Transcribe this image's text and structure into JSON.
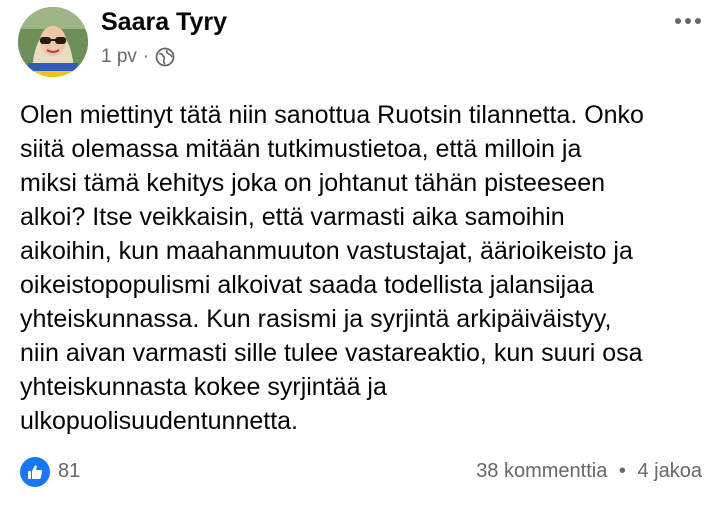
{
  "post": {
    "author": "Saara Tyry",
    "time": "1 pv",
    "separator": "·",
    "lines": [
      "Olen miettinyt tätä niin sanottua Ruotsin tilannetta. Onko",
      "siitä olemassa mitään tutkimustietoa, että milloin ja",
      "miksi tämä kehitys joka on johtanut tähän pisteeseen",
      "alkoi? Itse veikkaisin, että varmasti aika samoihin",
      "aikoihin, kun maahanmuuton vastustajat, äärioikeisto ja",
      "oikeistopopulismi alkoivat saada todellista jalansijaa",
      "yhteiskunnassa. Kun rasismi ja syrjintä arkipäiväistyy,",
      "niin aivan varmasti sille tulee vastareaktio, kun suuri osa",
      "yhteiskunnasta kokee syrjintää ja",
      "ulkopuolisuudentunnetta."
    ]
  },
  "footer": {
    "likes": "81",
    "comments": "38 kommenttia",
    "bullet": "•",
    "shares": "4 jakoa"
  },
  "icons": {
    "audience": "globe-icon",
    "options": "more-options-icon",
    "reaction": "like-icon"
  },
  "colors": {
    "like_blue": "#1877f2",
    "secondary_text": "#65676b",
    "primary_text": "#050505"
  }
}
